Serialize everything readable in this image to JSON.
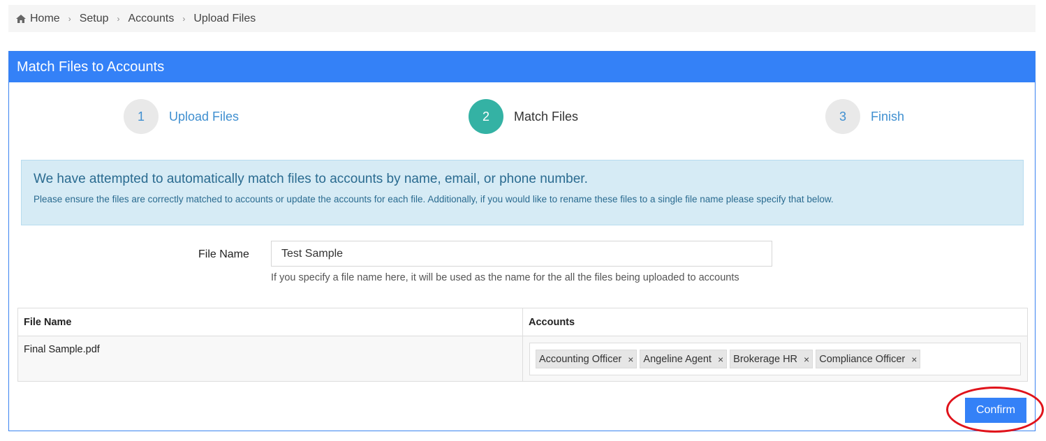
{
  "breadcrumb": {
    "items": [
      {
        "label": "Home"
      },
      {
        "label": "Setup"
      },
      {
        "label": "Accounts"
      },
      {
        "label": "Upload Files"
      }
    ]
  },
  "panel": {
    "title": "Match Files to Accounts"
  },
  "steps": [
    {
      "number": "1",
      "label": "Upload Files",
      "active": false
    },
    {
      "number": "2",
      "label": "Match Files",
      "active": true
    },
    {
      "number": "3",
      "label": "Finish",
      "active": false
    }
  ],
  "alert": {
    "title": "We have attempted to automatically match files to accounts by name, email, or phone number.",
    "body": "Please ensure the files are correctly matched to accounts or update the accounts for each file. Additionally, if you would like to rename these files to a single file name please specify that below."
  },
  "file_name_field": {
    "label": "File Name",
    "value": "Test Sample",
    "help": "If you specify a file name here, it will be used as the name for the all the files being uploaded to accounts"
  },
  "table": {
    "headers": [
      "File Name",
      "Accounts"
    ],
    "rows": [
      {
        "file": "Final Sample.pdf",
        "accounts": [
          "Accounting Officer",
          "Angeline Agent",
          "Brokerage HR",
          "Compliance Officer"
        ]
      }
    ]
  },
  "buttons": {
    "confirm": "Confirm"
  },
  "icons": {
    "home": "home-icon",
    "separator": "chevron-right-icon",
    "remove": "×"
  },
  "colors": {
    "primary": "#3481f7",
    "active_step": "#34b2a4",
    "alert_bg": "#d6ebf5",
    "annotation": "#e0131b"
  }
}
